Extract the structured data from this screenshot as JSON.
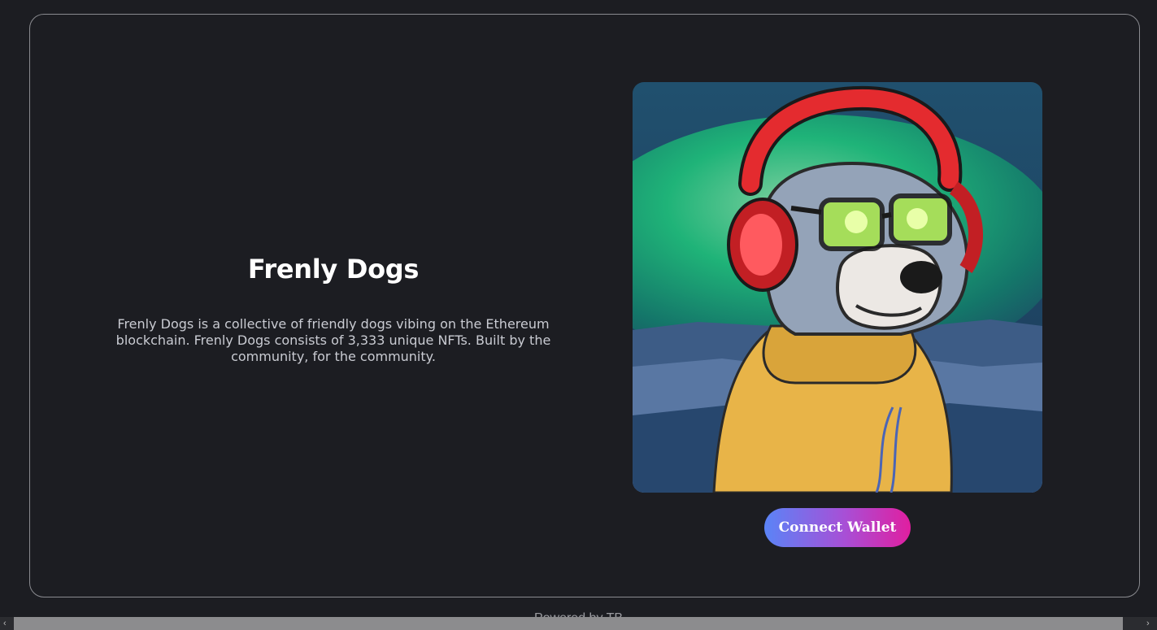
{
  "hero": {
    "title": "Frenly Dogs",
    "description": "Frenly Dogs is a collective of friendly dogs vibing on the Ethereum blockchain. Frenly Dogs consists of 3,333 unique NFTs. Built by the community, for the community."
  },
  "artwork": {
    "subject": "dog-with-headphones-illustration"
  },
  "actions": {
    "connect_wallet_label": "Connect Wallet"
  },
  "footer": {
    "text": "Powered by TB"
  },
  "scrollbar": {
    "left_arrow": "‹",
    "right_arrow": "›"
  },
  "colors": {
    "background": "#1c1d22",
    "card_border": "#8a8b90",
    "button_gradient_start": "#5a84f7",
    "button_gradient_end": "#e01fa0"
  }
}
